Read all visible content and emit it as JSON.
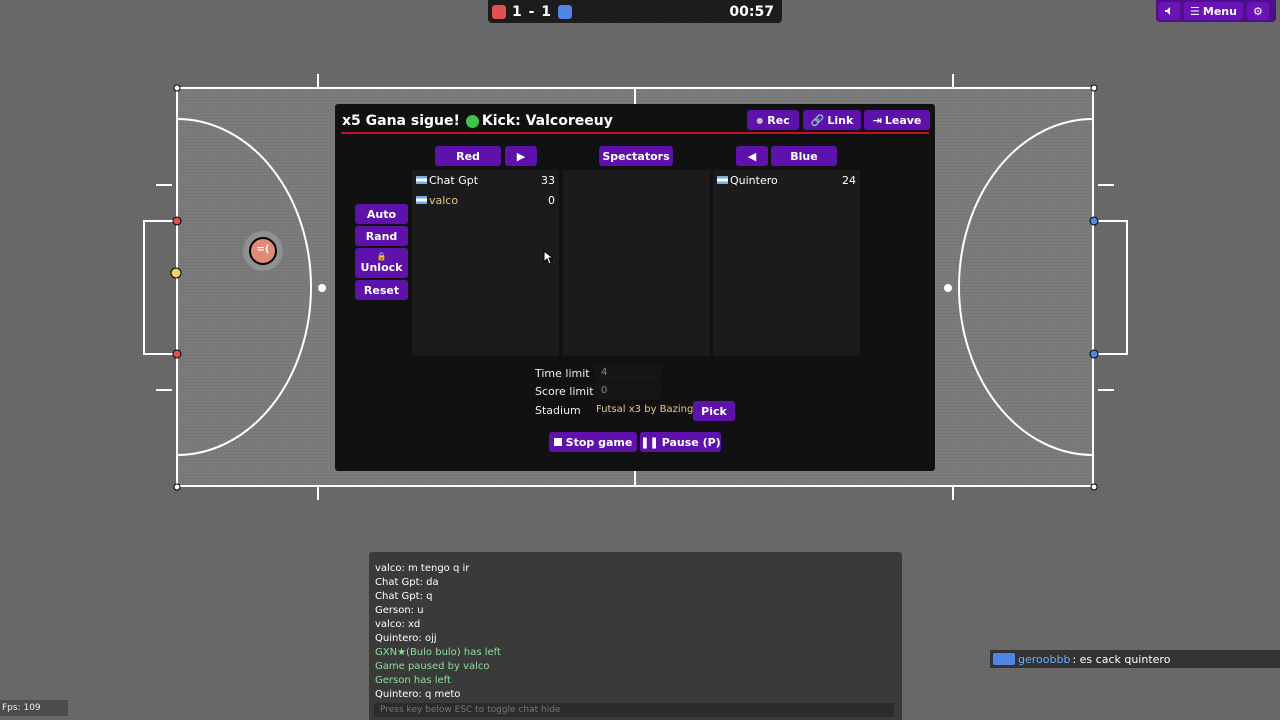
{
  "scoreboard": {
    "score": "1 - 1",
    "timer": "00:57",
    "red_color": "#e0524d",
    "blue_color": "#4f86e6"
  },
  "top_menu": {
    "sound_icon": "speaker-icon",
    "menu_label": "Menu",
    "settings_icon": "gear-icon"
  },
  "field": {
    "player_avatar": "=(",
    "player_fill": "#e0524d"
  },
  "room": {
    "title": "x5 Gana sigue!",
    "kick_label": "Kick: Valcoreeuy",
    "rec_label": "Rec",
    "link_label": "Link",
    "leave_label": "Leave",
    "red_label": "Red",
    "spectators_label": "Spectators",
    "blue_label": "Blue",
    "red_arrow": "▶",
    "blue_arrow": "◀",
    "auto_label": "Auto",
    "rand_label": "Rand",
    "unlock_label": "Unlock",
    "reset_label": "Reset",
    "red_team": [
      {
        "name": "Chat Gpt",
        "score": "33",
        "highlight": false
      },
      {
        "name": "valco",
        "score": "0",
        "highlight": true
      }
    ],
    "blue_team": [
      {
        "name": "Quintero",
        "score": "24",
        "highlight": false
      }
    ],
    "time_limit_label": "Time limit",
    "time_limit_value": "4",
    "score_limit_label": "Score limit",
    "score_limit_value": "0",
    "stadium_label": "Stadium",
    "stadium_value": "Futsal x3 by Bazinga ...",
    "pick_label": "Pick",
    "stop_label": "Stop game",
    "pause_label": "Pause (P)"
  },
  "chat": {
    "messages": [
      {
        "text": "valco: m tengo q ir",
        "type": "normal"
      },
      {
        "text": "Chat Gpt: da",
        "type": "normal"
      },
      {
        "text": "Chat Gpt: q",
        "type": "normal"
      },
      {
        "text": "Gerson: u",
        "type": "normal"
      },
      {
        "text": "valco: xd",
        "type": "normal"
      },
      {
        "text": "Quintero: ojj",
        "type": "normal"
      },
      {
        "text": "GXN★(Bulo bulo) has left",
        "type": "system"
      },
      {
        "text": "Game paused by valco",
        "type": "system"
      },
      {
        "text": "Gerson has left",
        "type": "system"
      },
      {
        "text": "Quintero: q meto",
        "type": "normal"
      }
    ],
    "input_placeholder": "Press key below ESC to toggle chat hide",
    "system_color": "#8fe09a"
  },
  "notification": {
    "user": "geroobbb",
    "message": ": es cack quintero"
  },
  "fps": "Fps: 109"
}
